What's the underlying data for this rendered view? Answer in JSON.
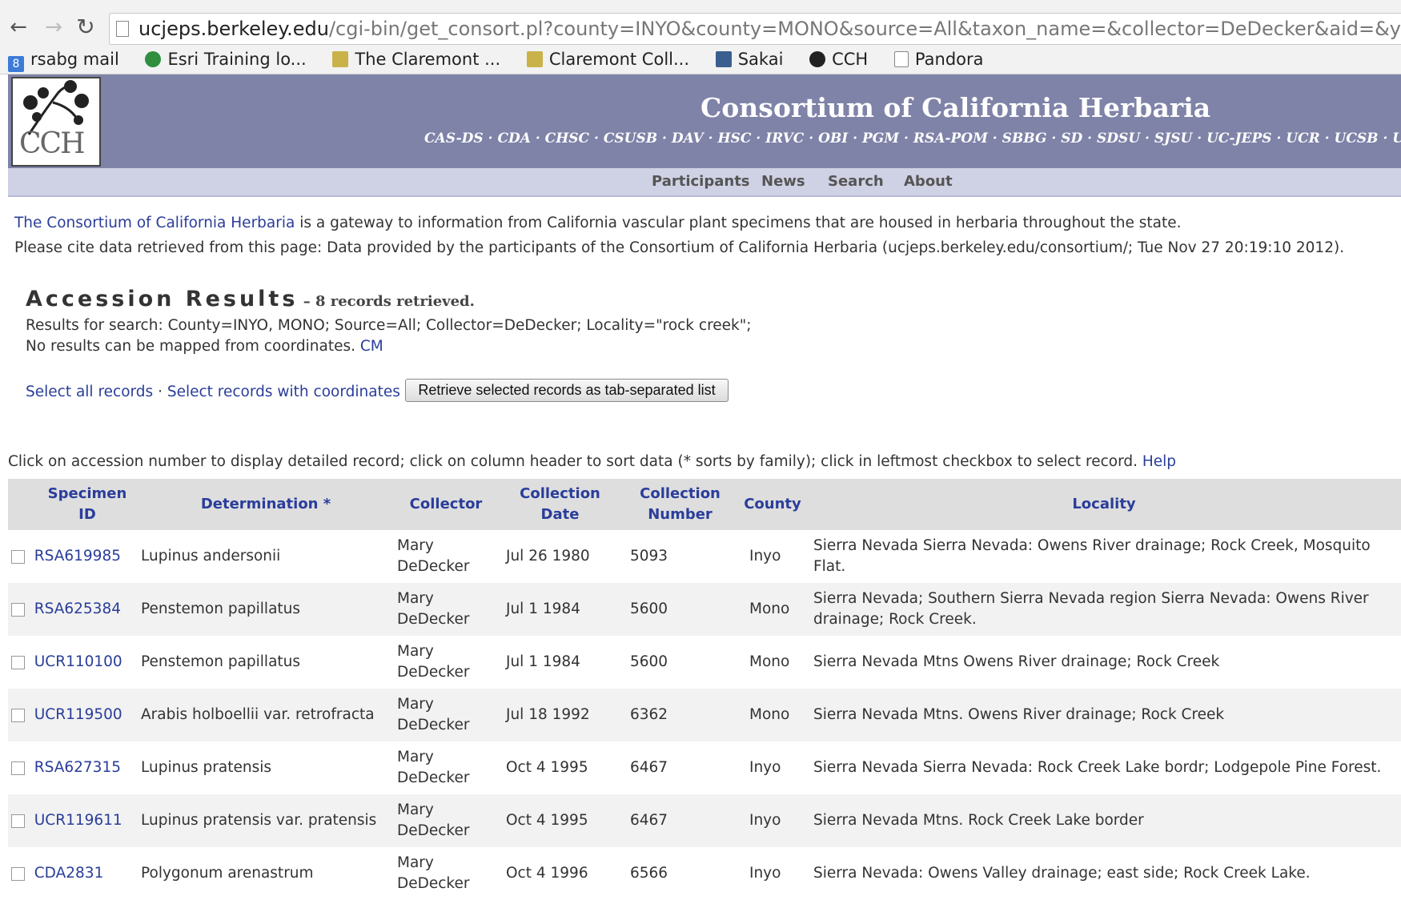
{
  "browser": {
    "url_host": "ucjeps.berkeley.edu",
    "url_path": "/cgi-bin/get_consort.pl?county=INYO&county=MONO&source=All&taxon_name=&collector=DeDecker&aid=&year=&mont",
    "bookmarks": [
      {
        "label": "rsabg mail",
        "icon": "mail-icon"
      },
      {
        "label": "Esri Training lo...",
        "icon": "globe-icon"
      },
      {
        "label": "The Claremont ...",
        "icon": "folder-icon"
      },
      {
        "label": "Claremont Coll...",
        "icon": "folder-icon"
      },
      {
        "label": "Sakai",
        "icon": "sakai-icon"
      },
      {
        "label": "CCH",
        "icon": "cch-icon"
      },
      {
        "label": "Pandora",
        "icon": "page-icon"
      }
    ]
  },
  "header": {
    "logo_text": "CCH",
    "title": "Consortium of California Herbaria",
    "herbaria": "CAS-DS · CDA · CHSC · CSUSB · DAV · HSC · IRVC · OBI · PGM · RSA-POM · SBBG · SD · SDSU · SJSU · UC-JEPS · UCR · UCSB · UCSC",
    "nav": [
      "Participants",
      "News",
      "Search",
      "About"
    ]
  },
  "intro": {
    "link": "The Consortium of California Herbaria",
    "rest": " is a gateway to information from California vascular plant specimens that are housed in herbaria throughout the state.",
    "cite": "Please cite data retrieved from this page: Data provided by the participants of the Consortium of California Herbaria (ucjeps.berkeley.edu/consortium/; Tue Nov 27 20:19:10 2012)."
  },
  "results": {
    "title": "Accession Results",
    "count": " – 8 records retrieved.",
    "search_line": "Results for search: County=INYO, MONO; Source=All; Collector=DeDecker; Locality=\"rock creek\";",
    "no_map": "No results can be mapped from coordinates.",
    "cm_link": "CM",
    "select_all": "Select all records",
    "sep1": " · ",
    "select_coords": "Select records with coordinates",
    "sep2": " ·",
    "retrieve_btn": "Retrieve selected records as tab-separated list",
    "help_text": "Click on accession number to display detailed record; click on column header to sort data (* sorts by family); click in leftmost checkbox to select record.",
    "help_link": "Help"
  },
  "table": {
    "headers": {
      "specimen_id": "Specimen ID",
      "determination": "Determination *",
      "collector": "Collector",
      "date": "Collection Date",
      "number": "Collection Number",
      "county": "County",
      "locality": "Locality"
    },
    "rows": [
      {
        "id": "RSA619985",
        "det": "Lupinus andersonii",
        "col": "Mary DeDecker",
        "date": "Jul 26 1980",
        "num": "5093",
        "county": "Inyo",
        "loc": "Sierra Nevada Sierra Nevada: Owens River drainage; Rock Creek, Mosquito Flat."
      },
      {
        "id": "RSA625384",
        "det": "Penstemon papillatus",
        "col": "Mary DeDecker",
        "date": "Jul 1 1984",
        "num": "5600",
        "county": "Mono",
        "loc": "Sierra Nevada; Southern Sierra Nevada region Sierra Nevada: Owens River drainage; Rock Creek."
      },
      {
        "id": "UCR110100",
        "det": "Penstemon papillatus",
        "col": "Mary DeDecker",
        "date": "Jul 1 1984",
        "num": "5600",
        "county": "Mono",
        "loc": "Sierra Nevada Mtns Owens River drainage; Rock Creek"
      },
      {
        "id": "UCR119500",
        "det": "Arabis holboellii var. retrofracta",
        "col": "Mary DeDecker",
        "date": "Jul 18 1992",
        "num": "6362",
        "county": "Mono",
        "loc": "Sierra Nevada Mtns. Owens River drainage; Rock Creek"
      },
      {
        "id": "RSA627315",
        "det": "Lupinus pratensis",
        "col": "Mary DeDecker",
        "date": "Oct 4 1995",
        "num": "6467",
        "county": "Inyo",
        "loc": "Sierra Nevada Sierra Nevada: Rock Creek Lake bordr; Lodgepole Pine Forest."
      },
      {
        "id": "UCR119611",
        "det": "Lupinus pratensis var. pratensis",
        "col": "Mary DeDecker",
        "date": "Oct 4 1995",
        "num": "6467",
        "county": "Inyo",
        "loc": "Sierra Nevada Mtns. Rock Creek Lake border"
      },
      {
        "id": "CDA2831",
        "det": "Polygonum arenastrum",
        "col": "Mary DeDecker",
        "date": "Oct 4 1996",
        "num": "6566",
        "county": "Inyo",
        "loc": "Sierra Nevada: Owens Valley drainage; east side; Rock Creek Lake."
      }
    ]
  }
}
